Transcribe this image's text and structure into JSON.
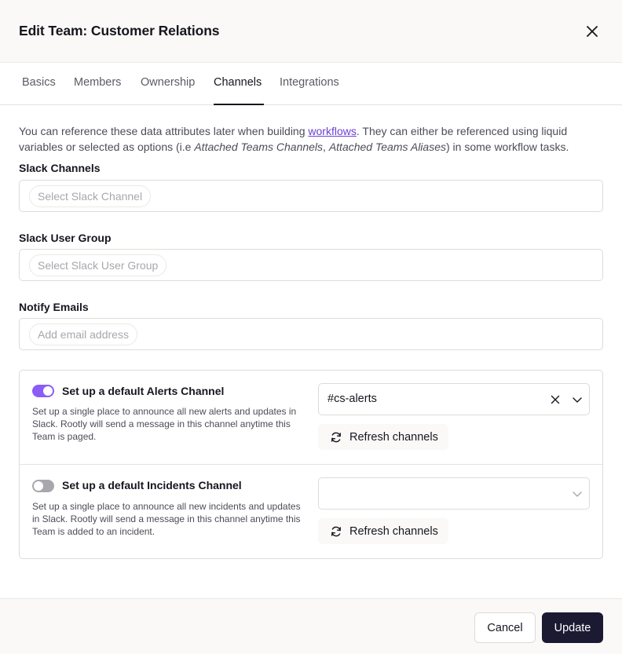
{
  "dialog": {
    "title": "Edit Team: Customer Relations",
    "close_icon": "close-icon"
  },
  "tabs": [
    {
      "label": "Basics",
      "active": false
    },
    {
      "label": "Members",
      "active": false
    },
    {
      "label": "Ownership",
      "active": false
    },
    {
      "label": "Channels",
      "active": true
    },
    {
      "label": "Integrations",
      "active": false
    }
  ],
  "intro": {
    "part1": "You can reference these data attributes later when building ",
    "link": "workflows",
    "part2": ". They can either be referenced using liquid variables or selected as options (i.e ",
    "em1": "Attached Teams Channels",
    "sep": ", ",
    "em2": "Attached Teams Aliases",
    "part3": ") in some workflow tasks."
  },
  "fields": {
    "slack_channels": {
      "label": "Slack Channels",
      "placeholder": "Select Slack Channel"
    },
    "slack_user_group": {
      "label": "Slack User Group",
      "placeholder": "Select Slack User Group"
    },
    "notify_emails": {
      "label": "Notify Emails",
      "placeholder": "Add email address"
    }
  },
  "alerts_channel": {
    "enabled": true,
    "title": "Set up a default Alerts Channel",
    "description": "Set up a single place to announce all new alerts and updates in Slack. Rootly will send a message in this channel anytime this Team is paged.",
    "selected": "#cs-alerts",
    "refresh_label": "Refresh channels"
  },
  "incidents_channel": {
    "enabled": false,
    "title": "Set up a default Incidents Channel",
    "description": "Set up a single place to announce all new incidents and updates in Slack. Rootly will send a message in this channel anytime this Team is added to an incident.",
    "selected": "",
    "refresh_label": "Refresh channels"
  },
  "footer": {
    "cancel_label": "Cancel",
    "update_label": "Update"
  },
  "colors": {
    "accent": "#8b5cf6",
    "link": "#6b3fd4",
    "primary_button": "#1c1a33"
  }
}
